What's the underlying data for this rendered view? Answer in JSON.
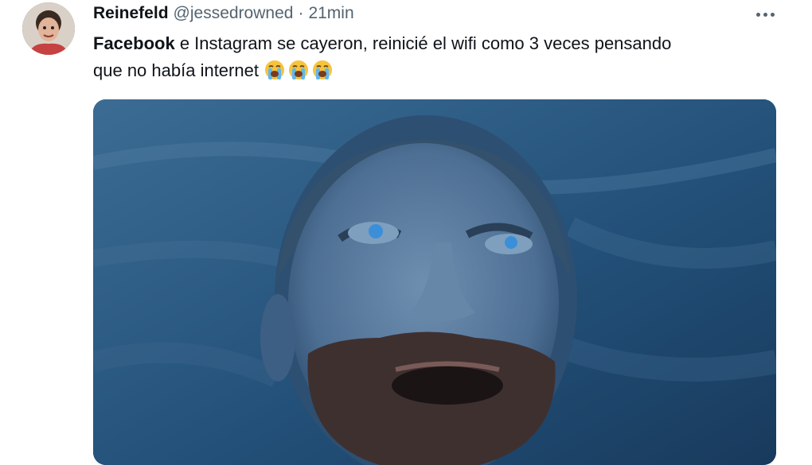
{
  "tweet": {
    "author_name": "Reinefeld",
    "handle": "@jessedrowned",
    "separator": "·",
    "time": "21min",
    "text_bold": "Facebook",
    "text_line1": " e Instagram se cayeron, reinicié el wifi como 3 veces pensando",
    "text_line2": "que no había internet",
    "emojis": [
      "loudly-crying-face",
      "loudly-crying-face",
      "loudly-crying-face"
    ],
    "more_icon": "more-horizontal-icon",
    "media_description_icon": "photo-man-looking-up"
  },
  "colors": {
    "text_primary": "#0f1419",
    "text_secondary": "#536471",
    "photo_tone": "#1f4a6f"
  }
}
